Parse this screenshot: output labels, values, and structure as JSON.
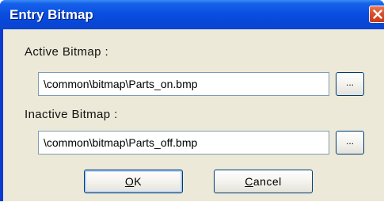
{
  "window": {
    "title": "Entry Bitmap"
  },
  "active": {
    "label": "Active Bitmap :",
    "value": "\\common\\bitmap\\Parts_on.bmp",
    "browse_label": "..."
  },
  "inactive": {
    "label": "Inactive Bitmap :",
    "value": "\\common\\bitmap\\Parts_off.bmp",
    "browse_label": "..."
  },
  "buttons": {
    "ok_label": "OK",
    "cancel_label": "Cancel"
  },
  "icons": {
    "close": "close-icon"
  },
  "colors": {
    "titlebar": "#0a4fe0",
    "client_bg": "#ece9d8",
    "close_button": "#d9502b"
  }
}
